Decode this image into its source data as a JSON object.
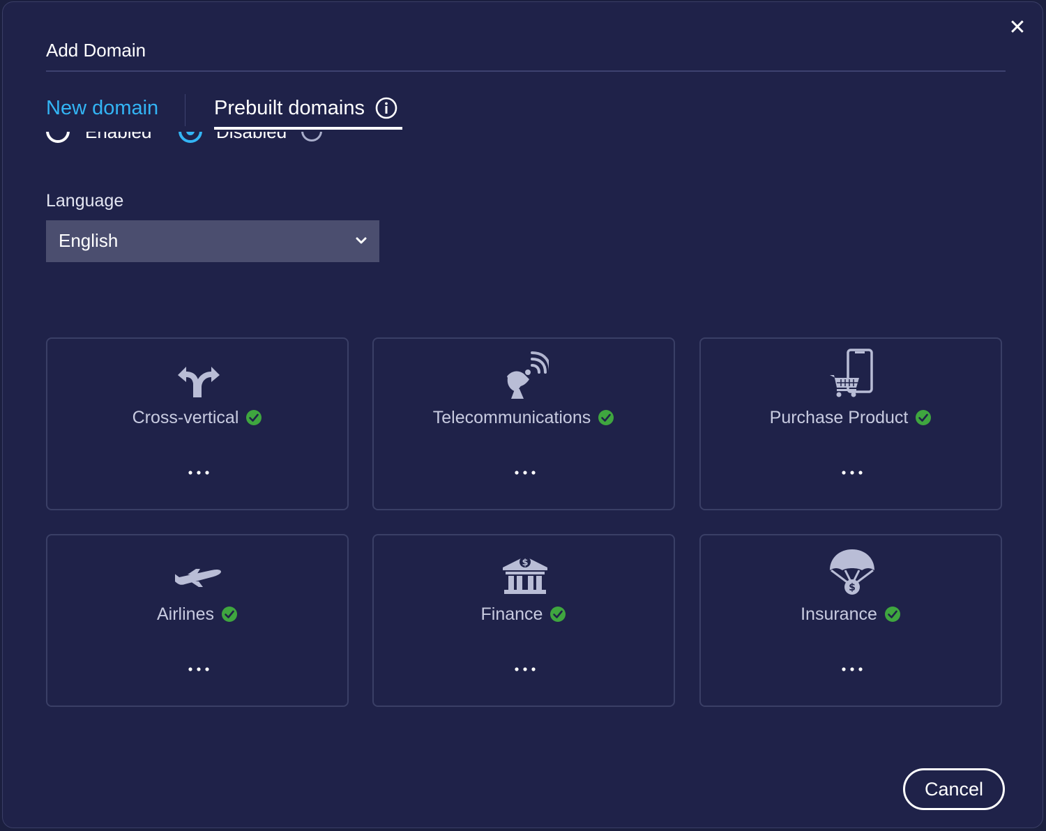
{
  "dialog": {
    "title": "Add Domain",
    "close_glyph": "✕"
  },
  "tabs": [
    {
      "label": "New domain",
      "active": false,
      "color": "#33b5f5"
    },
    {
      "label": "Prebuilt domains",
      "active": true,
      "color": "#ffffff"
    }
  ],
  "radio_group": {
    "options": [
      {
        "label": "Enabled",
        "selected": false
      },
      {
        "label": "Disabled",
        "selected": true
      }
    ]
  },
  "language": {
    "label": "Language",
    "selected": "English"
  },
  "domains": [
    {
      "name": "Cross-vertical",
      "icon": "split-arrows-icon",
      "enabled": true
    },
    {
      "name": "Telecommunications",
      "icon": "satellite-dish-icon",
      "enabled": true
    },
    {
      "name": "Purchase Product",
      "icon": "phone-cart-icon",
      "enabled": true
    },
    {
      "name": "Airlines",
      "icon": "airplane-icon",
      "enabled": true
    },
    {
      "name": "Finance",
      "icon": "bank-icon",
      "enabled": true
    },
    {
      "name": "Insurance",
      "icon": "parachute-money-icon",
      "enabled": true
    }
  ],
  "footer": {
    "cancel_label": "Cancel"
  },
  "colors": {
    "background": "#1f2249",
    "accent": "#33b5f5",
    "check": "#3fa63f",
    "icon": "#b9bdd6"
  }
}
